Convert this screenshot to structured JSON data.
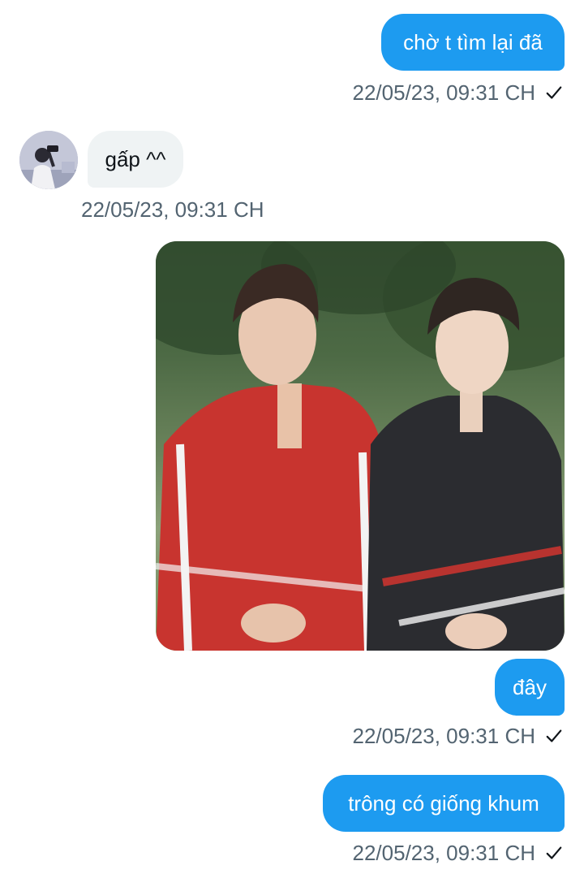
{
  "messages": [
    {
      "direction": "outgoing",
      "text": "chờ t tìm lại đã",
      "timestamp": "22/05/23, 09:31 CH",
      "read_icon": "check-icon"
    },
    {
      "direction": "incoming",
      "text": "gấp ^^",
      "timestamp": "22/05/23, 09:31 CH",
      "avatar_icon": "user-avatar"
    },
    {
      "direction": "outgoing",
      "type": "image",
      "image_alt_icon": "photo-two-people"
    },
    {
      "direction": "outgoing",
      "text": "đây",
      "timestamp": "22/05/23, 09:31 CH",
      "read_icon": "check-icon"
    },
    {
      "direction": "outgoing",
      "text": "trông có giống khum",
      "timestamp": "22/05/23, 09:31 CH",
      "read_icon": "check-icon"
    }
  ],
  "colors": {
    "outgoing_bubble": "#1d9bf0",
    "incoming_bubble": "#eff3f4",
    "timestamp_text": "#536471",
    "incoming_text": "#0f1419"
  }
}
